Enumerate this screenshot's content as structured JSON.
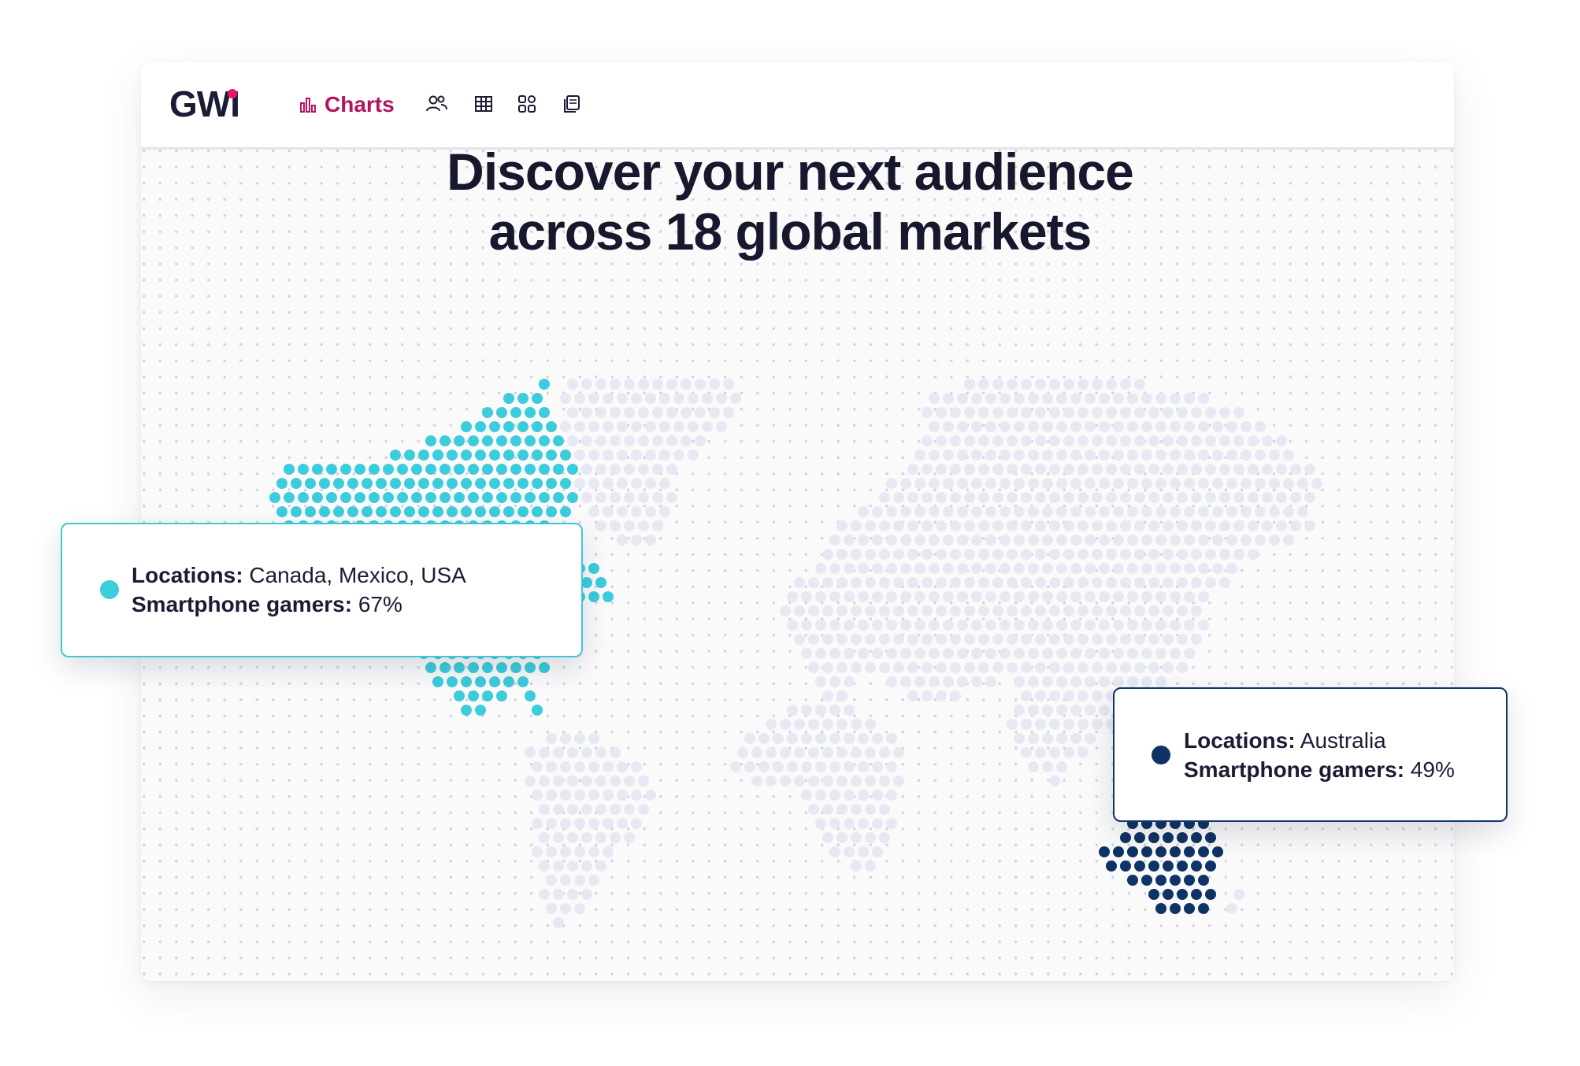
{
  "brand": {
    "logo_text": "GWI",
    "accent_color": "#e6136f"
  },
  "nav": {
    "active_label": "Charts",
    "active_color": "#b3145f",
    "icons": [
      "bar-chart-icon",
      "audiences-icon",
      "table-icon",
      "dashboards-icon",
      "reports-icon"
    ]
  },
  "headline": {
    "line1": "Discover your next audience",
    "line2": "across 18 global markets"
  },
  "map": {
    "base_color": "#e6e9f4",
    "highlight_north_america": "#3cccdc",
    "highlight_australia": "#0e3364"
  },
  "tooltips": {
    "north_america": {
      "locations_label": "Locations:",
      "locations_value": "Canada, Mexico, USA",
      "metric_label": "Smartphone gamers:",
      "metric_value": "67%"
    },
    "australia": {
      "locations_label": "Locations:",
      "locations_value": "Australia",
      "metric_label": "Smartphone gamers:",
      "metric_value": "49%"
    }
  }
}
